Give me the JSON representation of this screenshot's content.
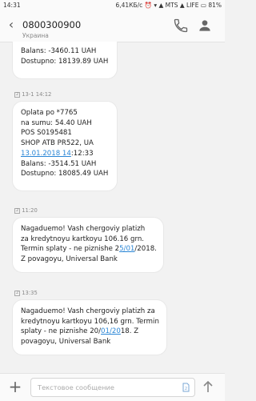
{
  "status_bar": {
    "time": "14:31",
    "indicators": "6,41КБ/с ⏰ ▾ ▲ MTS ▲ LIFE ▭ 81%"
  },
  "header": {
    "contact": "0800300900",
    "country": "Украина"
  },
  "messages": [
    {
      "timestamp": "",
      "lines": [
        "Balans: -3460.11 UAH",
        "Dostupno: 18139.89 UAH"
      ]
    },
    {
      "timestamp": "13-1 14:12",
      "sim": "2",
      "lines": [
        "Oplata po *7765",
        "na sumu: 54.40 UAH",
        "POS S0195481",
        "SHOP ATB PR522, UA"
      ],
      "date_line": {
        "link": "13.01.2018 14",
        "rest": ":12:33"
      },
      "tail_lines": [
        "Balans: -3514.51 UAH",
        "Dostupno: 18085.49 UAH"
      ]
    },
    {
      "timestamp": "11:20",
      "sim": "2",
      "lines": [
        "Nagaduemo! Vash chergoviy platizh",
        "za kredytnoyu kartkoyu 106.16 grn.",
        "Termin splaty - ne piznishe 25/01/2018.",
        "Z povagoyu, Universal Bank"
      ]
    },
    {
      "timestamp": "13:35",
      "sim": "2",
      "lines": [
        "Nagaduemo! Vash chergoviy platizh za",
        "kredytnoyu kartkoyu 106,16 grn. Termin",
        "splaty - ne piznishe 20/01/2018. Z",
        "povagoyu, Universal Bank"
      ]
    }
  ],
  "composer": {
    "placeholder": "Текстовое сообщение",
    "sim": "2"
  }
}
